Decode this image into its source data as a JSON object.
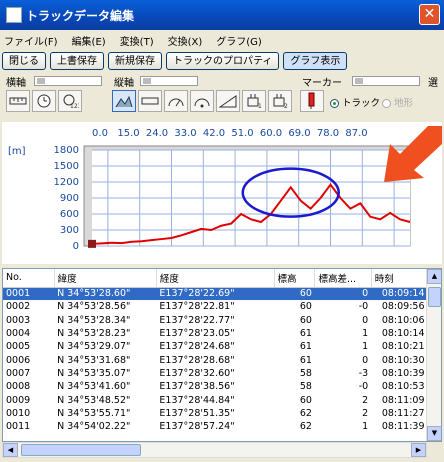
{
  "window": {
    "title": "トラックデータ編集",
    "close": "✕"
  },
  "menu": [
    "ファイル(F)",
    "編集(E)",
    "変換(T)",
    "交換(X)",
    "グラフ(G)"
  ],
  "buttons": [
    "閉じる",
    "上書保存",
    "新規保存",
    "トラックのプロパティ",
    "グラフ表示"
  ],
  "toolbar": {
    "horizontal_axis": "横軸",
    "vertical_axis": "縦軸",
    "marker": "マーカー",
    "radio_track": "トラック",
    "radio_terrain": "地形",
    "select_cut": "選",
    "radio_track_selected": true
  },
  "chart_data": {
    "type": "line",
    "x_ticks": [
      "0.0",
      "15.0",
      "24.0",
      "33.0",
      "42.0",
      "51.0",
      "60.0",
      "69.0",
      "78.0",
      "87.0"
    ],
    "y_ticks": [
      "1800",
      "1500",
      "1200",
      "900",
      "600",
      "300",
      "0"
    ],
    "ylabel": "[m]",
    "ylim": [
      0,
      1800
    ],
    "xlim": [
      0,
      96
    ],
    "series": [
      {
        "color": "#e00000",
        "x": [
          0,
          3,
          6,
          9,
          12,
          15,
          18,
          21,
          24,
          27,
          30,
          33,
          36,
          39,
          42,
          45,
          48,
          51,
          54,
          57,
          60,
          63,
          66,
          69,
          72,
          75,
          78,
          81,
          84,
          87,
          90,
          93,
          96
        ],
        "y": [
          40,
          50,
          60,
          55,
          80,
          90,
          110,
          130,
          150,
          200,
          260,
          320,
          300,
          380,
          420,
          600,
          500,
          450,
          600,
          850,
          1100,
          850,
          700,
          900,
          1150,
          900,
          700,
          800,
          550,
          500,
          620,
          500,
          450
        ]
      }
    ],
    "annotation_color": "#1a1ad0",
    "arrow_color": "#f05020"
  },
  "table": {
    "columns": [
      "No.",
      "緯度",
      "経度",
      "標高",
      "標高差...",
      "時刻"
    ],
    "rows": [
      [
        "0001",
        "N 34°53'28.60\"",
        "E137°28'22.69\"",
        "60",
        "0",
        "08:09:14"
      ],
      [
        "0002",
        "N 34°53'28.56\"",
        "E137°28'22.81\"",
        "60",
        "-0",
        "08:09:56"
      ],
      [
        "0003",
        "N 34°53'28.34\"",
        "E137°28'22.77\"",
        "60",
        "0",
        "08:10:06"
      ],
      [
        "0004",
        "N 34°53'28.23\"",
        "E137°28'23.05\"",
        "61",
        "1",
        "08:10:14"
      ],
      [
        "0005",
        "N 34°53'29.07\"",
        "E137°28'24.68\"",
        "61",
        "1",
        "08:10:21"
      ],
      [
        "0006",
        "N 34°53'31.68\"",
        "E137°28'28.68\"",
        "61",
        "0",
        "08:10:30"
      ],
      [
        "0007",
        "N 34°53'35.07\"",
        "E137°28'32.60\"",
        "58",
        "-3",
        "08:10:39"
      ],
      [
        "0008",
        "N 34°53'41.60\"",
        "E137°28'38.56\"",
        "58",
        "-0",
        "08:10:53"
      ],
      [
        "0009",
        "N 34°53'48.52\"",
        "E137°28'44.84\"",
        "60",
        "2",
        "08:11:09"
      ],
      [
        "0010",
        "N 34°53'55.71\"",
        "E137°28'51.35\"",
        "62",
        "2",
        "08:11:27"
      ],
      [
        "0011",
        "N 34°54'02.22\"",
        "E137°28'57.24\"",
        "62",
        "1",
        "08:11:39"
      ]
    ]
  }
}
